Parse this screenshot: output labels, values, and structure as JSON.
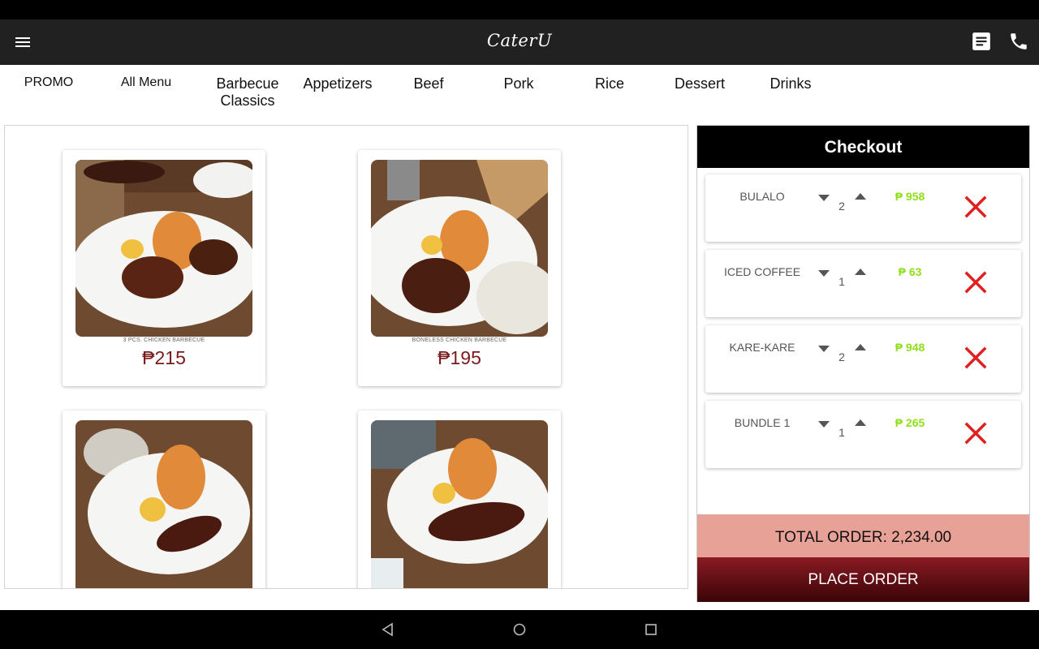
{
  "app": {
    "logo_text": "CaterU"
  },
  "toolbar": {
    "menu_icon": "hamburger-menu-icon",
    "receipt_icon": "receipt-icon",
    "phone_icon": "phone-icon"
  },
  "categories": [
    "PROMO",
    "All Menu",
    "Barbecue Classics",
    "Appetizers",
    "Beef",
    "Pork",
    "Rice",
    "Dessert",
    "Drinks"
  ],
  "menu_items": [
    {
      "name": "3 PCS. CHICKEN BARBECUE",
      "price": "₱215"
    },
    {
      "name": "BONELESS CHICKEN BARBECUE",
      "price": "₱195"
    },
    {
      "name": "",
      "price": ""
    },
    {
      "name": "",
      "price": ""
    }
  ],
  "checkout": {
    "title": "Checkout",
    "items": [
      {
        "name": "BULALO",
        "qty": "2",
        "price": "₱ 958"
      },
      {
        "name": "ICED COFFEE",
        "qty": "1",
        "price": "₱ 63"
      },
      {
        "name": "KARE-KARE",
        "qty": "2",
        "price": "₱ 948"
      },
      {
        "name": "BUNDLE 1",
        "qty": "1",
        "price": "₱ 265"
      }
    ],
    "total_label": "TOTAL ORDER: 2,234.00",
    "place_order_label": "PLACE ORDER"
  },
  "colors": {
    "appbar": "#212121",
    "price_red": "#7a1a1a",
    "checkout_price_green": "#8fe01b",
    "remove_red": "#e02020",
    "total_bg": "#e8a197",
    "place_order_bg": "#6b0f17"
  }
}
